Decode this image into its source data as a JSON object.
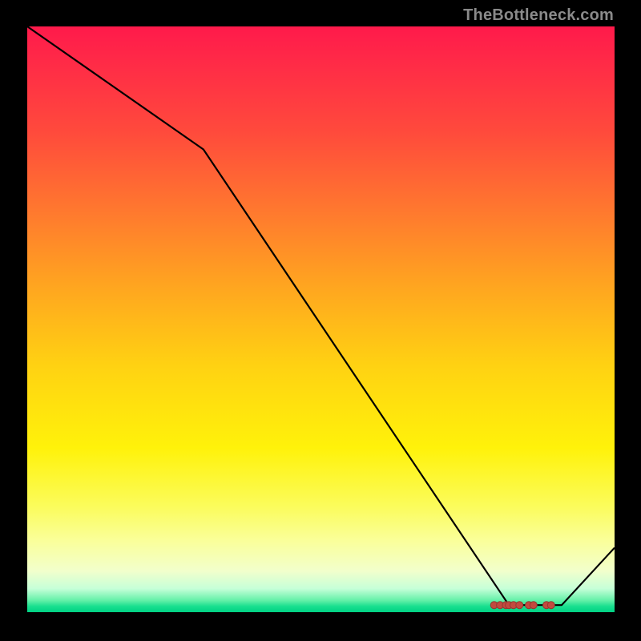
{
  "watermark": "TheBottleneck.com",
  "chart_data": {
    "type": "line",
    "title": "",
    "xlabel": "",
    "ylabel": "",
    "xlim": [
      0,
      100
    ],
    "ylim": [
      0,
      100
    ],
    "x": [
      0,
      30,
      82,
      91,
      100
    ],
    "values": [
      100,
      79,
      1.2,
      1.2,
      11
    ],
    "dot_cluster": {
      "y": 1.2,
      "x": [
        79.5,
        80.5,
        81.5,
        82,
        82.8,
        83.8,
        85.4,
        86.2,
        88.4,
        89.2
      ]
    },
    "gradient_stops": [
      {
        "pct": 0,
        "color": "#ff1a4b"
      },
      {
        "pct": 50,
        "color": "#ffd212"
      },
      {
        "pct": 88,
        "color": "#faff9c"
      },
      {
        "pct": 100,
        "color": "#00d184"
      }
    ]
  }
}
